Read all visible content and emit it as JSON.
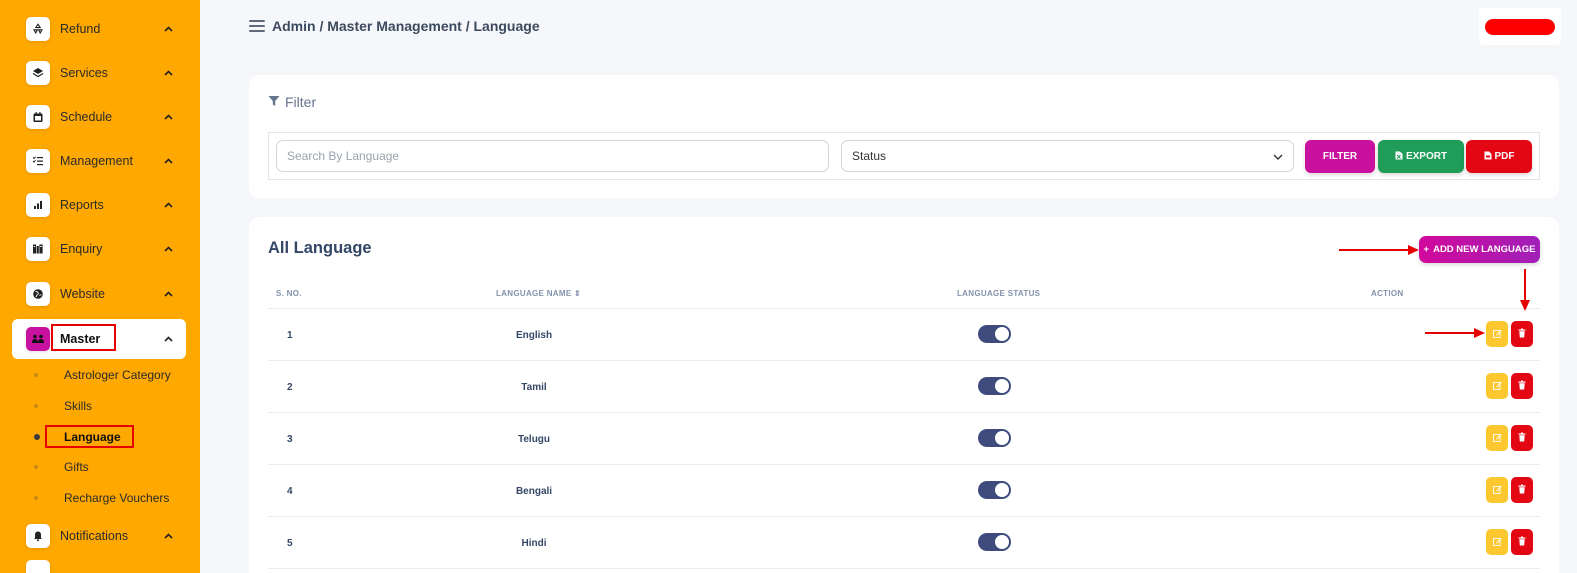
{
  "sidebar": {
    "items": [
      {
        "label": "Refund",
        "icon": "recycle-icon"
      },
      {
        "label": "Services",
        "icon": "layers-icon"
      },
      {
        "label": "Schedule",
        "icon": "calendar-icon"
      },
      {
        "label": "Management",
        "icon": "checklist-icon"
      },
      {
        "label": "Reports",
        "icon": "bar-chart-icon"
      },
      {
        "label": "Enquiry",
        "icon": "book-icon"
      },
      {
        "label": "Website",
        "icon": "globe-icon"
      },
      {
        "label": "Master",
        "icon": "users-icon"
      },
      {
        "label": "Notifications",
        "icon": "bell-icon"
      }
    ],
    "subitems": [
      {
        "label": "Astrologer Category"
      },
      {
        "label": "Skills"
      },
      {
        "label": "Language"
      },
      {
        "label": "Gifts"
      },
      {
        "label": "Recharge Vouchers"
      }
    ]
  },
  "header": {
    "breadcrumb": "Admin / Master Management / Language"
  },
  "filter": {
    "title": "Filter",
    "search_placeholder": "Search By Language",
    "status_label": "Status",
    "filter_button": "FILTER",
    "export_button": "EXPORT",
    "pdf_button": "PDF"
  },
  "table": {
    "title": "All Language",
    "add_button": "ADD NEW LANGUAGE",
    "columns": {
      "sno": "S. NO.",
      "name": "LANGUAGE NAME",
      "status": "LANGUAGE STATUS",
      "action": "ACTION"
    },
    "rows": [
      {
        "sno": "1",
        "name": "English",
        "active": true
      },
      {
        "sno": "2",
        "name": "Tamil",
        "active": true
      },
      {
        "sno": "3",
        "name": "Telugu",
        "active": true
      },
      {
        "sno": "4",
        "name": "Bengali",
        "active": true
      },
      {
        "sno": "5",
        "name": "Hindi",
        "active": true
      }
    ]
  },
  "colors": {
    "sidebar_bg": "#ffa800",
    "accent_magenta": "#c8119e",
    "export_green": "#1e9c58",
    "pdf_red": "#e30613",
    "edit_yellow": "#fdc72f",
    "toggle_on": "#3e4b7d",
    "annotation_red": "#e60000"
  }
}
